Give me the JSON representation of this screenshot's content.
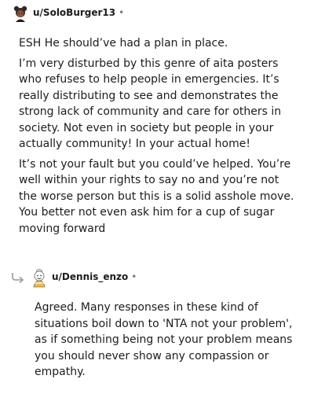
{
  "comments": [
    {
      "username": "u/SoloBurger13",
      "separator": "•",
      "avatar_icon": "user-avatar-icon",
      "paragraphs": [
        "ESH He should’ve had a plan in place.",
        "I’m very disturbed by this genre of aita posters who refuses to help people in emergencies. It’s really distributing to see and demonstrates the strong lack of community and care for others in society. Not even in society but people in your actually community! In your actual home!",
        "It’s not your fault but you could’ve helped. You’re well within your rights to say no and you’re not the worse person but this is a solid asshole move. You better not even ask him for a cup of sugar moving forward"
      ]
    },
    {
      "username": "u/Dennis_enzo",
      "separator": "•",
      "avatar_icon": "user-avatar-icon",
      "reply_icon": "reply-arrow-icon",
      "paragraphs": [
        "Agreed. Many responses in these kind of situations boil down to 'NTA not your problem', as if something being not your problem means you should never show any compassion or empathy."
      ]
    }
  ],
  "colors": {
    "text": "#1c1c1c",
    "meta": "#7c7c7c"
  }
}
